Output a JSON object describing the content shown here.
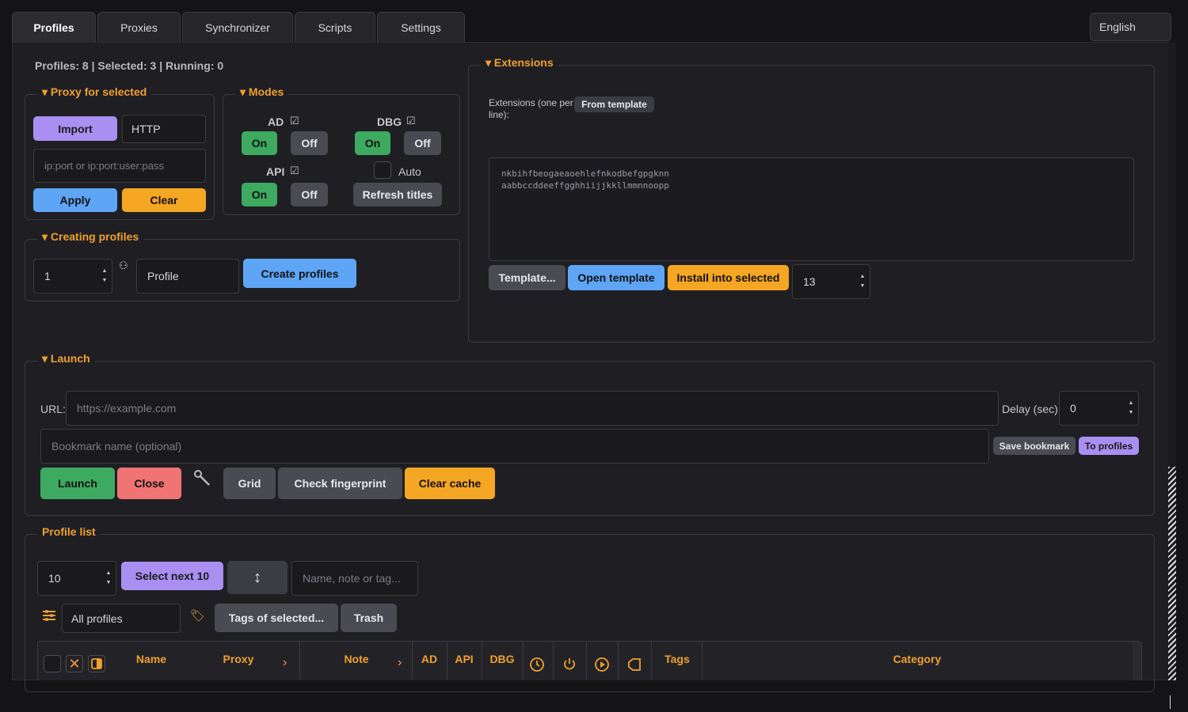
{
  "tabs": [
    "Profiles",
    "Proxies",
    "Synchronizer",
    "Scripts",
    "Settings"
  ],
  "language": "English",
  "stats": "Profiles: 8 | Selected: 3 | Running: 0",
  "proxy": {
    "legend": "Proxy for selected",
    "import_label": "Import",
    "type_value": "HTTP",
    "input_placeholder": "ip:port or ip:port:user:pass",
    "apply_label": "Apply",
    "clear_label": "Clear"
  },
  "modes": {
    "legend": "Modes",
    "ad_label": "AD",
    "dbg_label": "DBG",
    "api_label": "API",
    "on_label": "On",
    "off_label": "Off",
    "auto_label": "Auto",
    "refresh_label": "Refresh titles"
  },
  "creating": {
    "legend": "Creating profiles",
    "count_value": "1",
    "name_value": "Profile",
    "create_label": "Create profiles"
  },
  "extensions": {
    "legend": "Extensions",
    "description": "Extensions (one per line):",
    "from_template_label": "From template",
    "textarea_line1": "nkbihfbeogaeaoehlefnkodbefgpgknn",
    "textarea_line2": "aabbccddeeffgghhiijjkkllmmnnoopp",
    "template_label": "Template...",
    "open_template_label": "Open template",
    "install_label": "Install into selected",
    "number_value": "13"
  },
  "launch": {
    "legend": "Launch",
    "url_label": "URL:",
    "url_placeholder": "https://example.com",
    "delay_label": "Delay (sec):",
    "delay_value": "0",
    "bookmark_placeholder": "Bookmark name (optional)",
    "save_bookmark_label": "Save bookmark",
    "to_profiles_label": "To profiles",
    "launch_label": "Launch",
    "close_label": "Close",
    "grid_label": "Grid",
    "check_fingerprint_label": "Check fingerprint",
    "clear_cache_label": "Clear cache"
  },
  "profile_list": {
    "legend": "Profile list",
    "count_value": "10",
    "select_next_label": "Select next 10",
    "search_placeholder": "Name, note or tag...",
    "filter_value": "All profiles",
    "tags_of_selected_label": "Tags of selected...",
    "trash_label": "Trash",
    "columns": {
      "name": "Name",
      "proxy": "Proxy",
      "note": "Note",
      "ad": "AD",
      "api": "API",
      "dbg": "DBG",
      "tags": "Tags",
      "category": "Category"
    }
  },
  "colors": {
    "accent_orange": "#f0a030",
    "purple": "#a98ff2",
    "blue": "#5ea5f5",
    "green": "#3daa60",
    "red": "#f07474"
  }
}
